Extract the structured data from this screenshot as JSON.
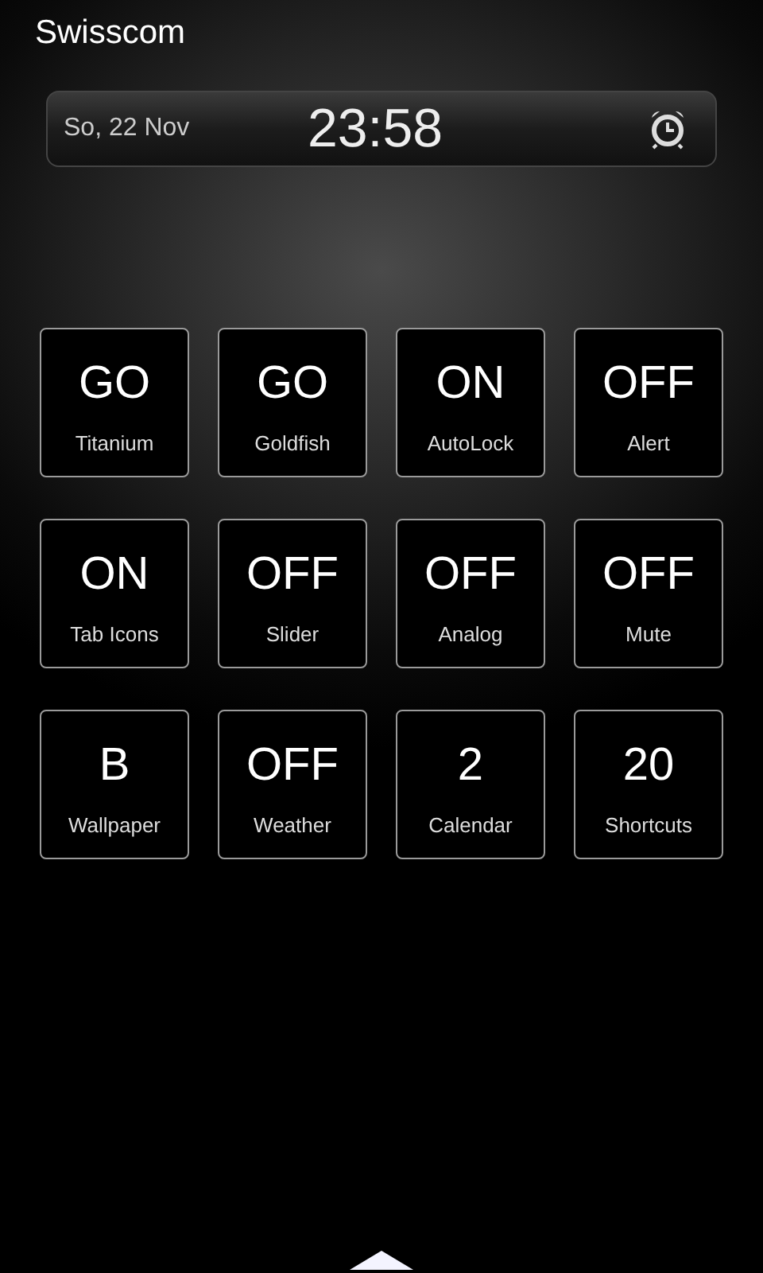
{
  "carrier": "Swisscom",
  "clock": {
    "date": "So, 22 Nov",
    "time": "23:58"
  },
  "tiles": [
    {
      "value": "GO",
      "label": "Titanium"
    },
    {
      "value": "GO",
      "label": "Goldfish"
    },
    {
      "value": "ON",
      "label": "AutoLock"
    },
    {
      "value": "OFF",
      "label": "Alert"
    },
    {
      "value": "ON",
      "label": "Tab Icons"
    },
    {
      "value": "OFF",
      "label": "Slider"
    },
    {
      "value": "OFF",
      "label": "Analog"
    },
    {
      "value": "OFF",
      "label": "Mute"
    },
    {
      "value": "B",
      "label": "Wallpaper"
    },
    {
      "value": "OFF",
      "label": "Weather"
    },
    {
      "value": "2",
      "label": "Calendar"
    },
    {
      "value": "20",
      "label": "Shortcuts"
    }
  ]
}
